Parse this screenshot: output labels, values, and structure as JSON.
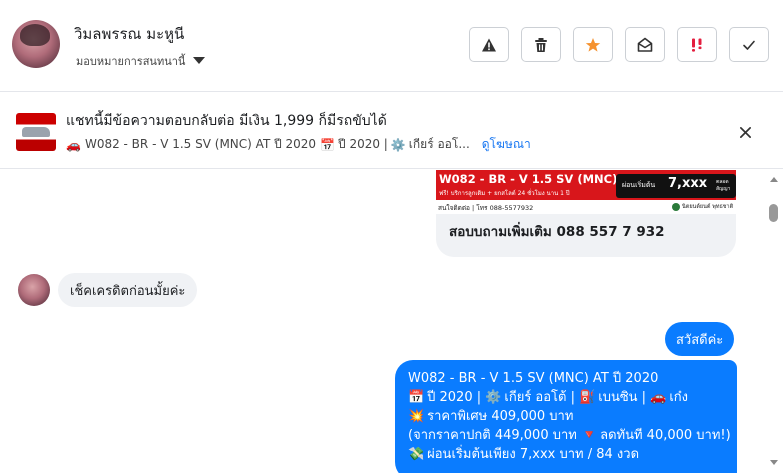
{
  "header": {
    "user_name": "วิมลพรรณ มะหูนี",
    "assign_label": "มอบหมายการสนทนานี้",
    "actions": [
      {
        "name": "spam-icon",
        "label": "!"
      },
      {
        "name": "trash-icon",
        "label": ""
      },
      {
        "name": "star-icon",
        "label": ""
      },
      {
        "name": "mark-unread-icon",
        "label": ""
      },
      {
        "name": "follow-up-icon",
        "label": ""
      },
      {
        "name": "check-icon",
        "label": ""
      }
    ]
  },
  "ad": {
    "title": "แชทนี้มีข้อความตอบกลับต่อ มีเงิน 1,999 ก็มีรถขับได้",
    "car_emoji": "🚗",
    "details": "W082 - BR - V 1.5 SV (MNC) AT ปี 2020",
    "calendar_emoji": "📅",
    "year_text": "ปี 2020 |",
    "gear_emoji": "⚙️",
    "gear_text": "เกียร์ ออโ...",
    "view_ad_link": "ดูโฆษณา"
  },
  "chat": {
    "card": {
      "image_title": "W082 - BR - V 1.5 SV (MNC)",
      "image_promo": "ฟรี! บริการลูกเดิม + ยกสโลต์ 24 ชั่วโมง นาน 1 ปี",
      "price_prefix": "ผ่อนเริ่มต้น",
      "price": "7,xxx",
      "price_suffix": "ตลอดสัญญา",
      "contact_line": "สนใจติดต่อ | โทร 088-5577932",
      "dealer": "นิตยนต์ยนต์ พุทธชาติ",
      "caption": "สอบบถามเพิ่มเติม  088 557 7 932"
    },
    "incoming": {
      "text": "เช็คเครดิตก่อนมั้ยค่ะ"
    },
    "outgoing_1": "สวัสดีค่ะ",
    "outgoing_2": {
      "line1": "W082 - BR - V 1.5 SV (MNC) AT ปี 2020",
      "line2_emoji": "📅",
      "line2_text": " ปี 2020 | ",
      "line2_gear": "⚙️",
      "line2_text2": " เกียร์ ออโต้ | ",
      "line2_fuel": "⛽",
      "line2_text3": " เบนซิน | ",
      "line2_car": "🚗",
      "line2_text4": " เก๋ง",
      "line3_emoji": "💥",
      "line3_text": " ราคาพิเศษ 409,000 บาท",
      "line4_text": "(จากราคาปกติ 449,000 บาท ",
      "line4_emoji": "🔻",
      "line4_text2": " ลดทันที 40,000 บาท!)",
      "line5_emoji": "💸",
      "line5_text": " ผ่อนเริ่มต้นเพียง 7,xxx บาท / 84 งวด"
    }
  }
}
